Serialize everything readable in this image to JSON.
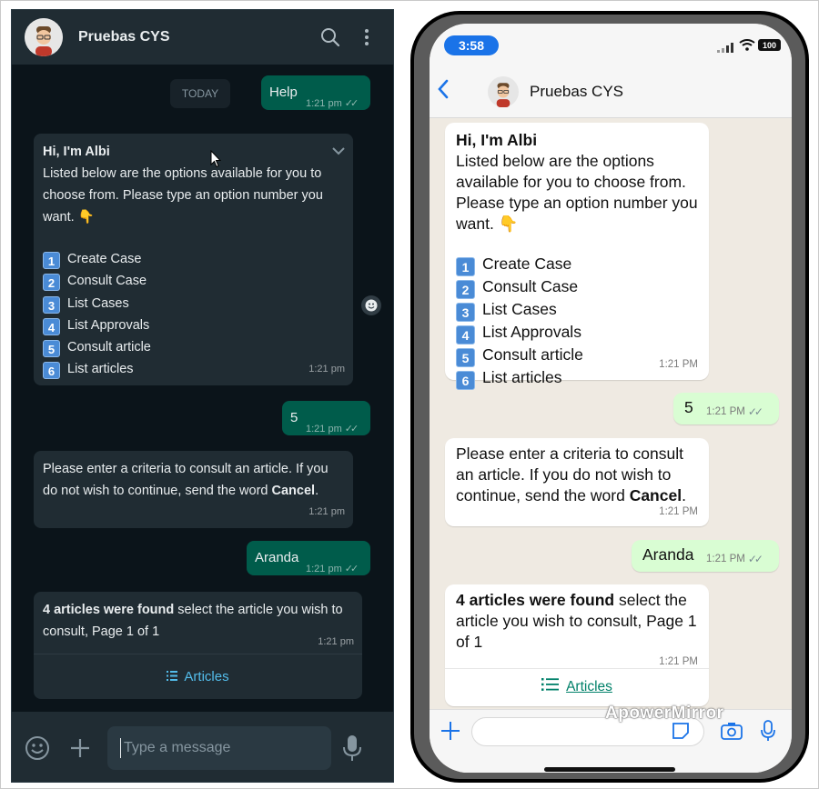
{
  "web": {
    "contact_name": "Pruebas CYS",
    "date_chip": "TODAY",
    "messages": [
      {
        "dir": "out",
        "text": "Help",
        "time": "1:21 pm"
      },
      {
        "dir": "in",
        "title": "Hi, I'm Albi",
        "text": "Listed below are the options available for you to choose from. Please type an option number you want. 👇",
        "time": "1:21 pm"
      },
      {
        "dir": "out",
        "text": "5",
        "time": "1:21 pm"
      },
      {
        "dir": "in",
        "text_pre": "Please enter a criteria to consult an article. If you do not wish to continue, send the word ",
        "text_bold": "Cancel",
        "text_post": ".",
        "time": "1:21 pm"
      },
      {
        "dir": "out",
        "text": "Aranda",
        "time": "1:21 pm"
      },
      {
        "dir": "in",
        "text_bold": "4 articles were found",
        "text_post": " select the article you wish to consult, Page 1 of 1",
        "time": "1:21 pm",
        "button": "Articles"
      }
    ],
    "input_placeholder": "Type a message"
  },
  "menu_options": [
    {
      "num": "1",
      "label": "Create Case"
    },
    {
      "num": "2",
      "label": "Consult Case"
    },
    {
      "num": "3",
      "label": "List Cases"
    },
    {
      "num": "4",
      "label": "List Approvals"
    },
    {
      "num": "5",
      "label": "Consult article"
    },
    {
      "num": "6",
      "label": "List articles"
    }
  ],
  "phone": {
    "status_time": "3:58",
    "battery": "100",
    "contact_name": "Pruebas CYS",
    "messages": [
      {
        "dir": "in",
        "title": "Hi, I'm Albi",
        "text": "Listed below are the options available for you to choose from. Please type an option number you want. 👇",
        "time": "1:21 PM"
      },
      {
        "dir": "out",
        "text": "5",
        "time": "1:21 PM"
      },
      {
        "dir": "in",
        "text_pre": "Please enter a criteria to consult an article. If you do not wish to continue, send the word ",
        "text_bold": "Cancel",
        "text_post": ".",
        "time": "1:21 PM"
      },
      {
        "dir": "out",
        "text": "Aranda",
        "time": "1:21 PM"
      },
      {
        "dir": "in",
        "text_bold": "4 articles were found",
        "text_post": " select the article you wish to consult, Page 1 of 1",
        "time": "1:21 PM",
        "button": "Articles"
      }
    ],
    "watermark": "ApowerMirror"
  },
  "colors": {
    "web_bg": "#0b141a",
    "web_header": "#202c33",
    "web_in_bubble": "#202c33",
    "web_out_bubble": "#005c4b",
    "web_link": "#53bdeb",
    "ios_out_bubble": "#d9fdd3",
    "ios_accent": "#1a73e8",
    "ios_link": "#008069"
  },
  "icons": [
    "search-icon",
    "kebab-menu-icon",
    "chevron-down-icon",
    "emoji-icon",
    "plus-icon",
    "mic-icon",
    "list-icon",
    "back-arrow-icon",
    "camera-icon",
    "sticker-icon",
    "signal-icon",
    "wifi-icon",
    "battery-icon"
  ]
}
